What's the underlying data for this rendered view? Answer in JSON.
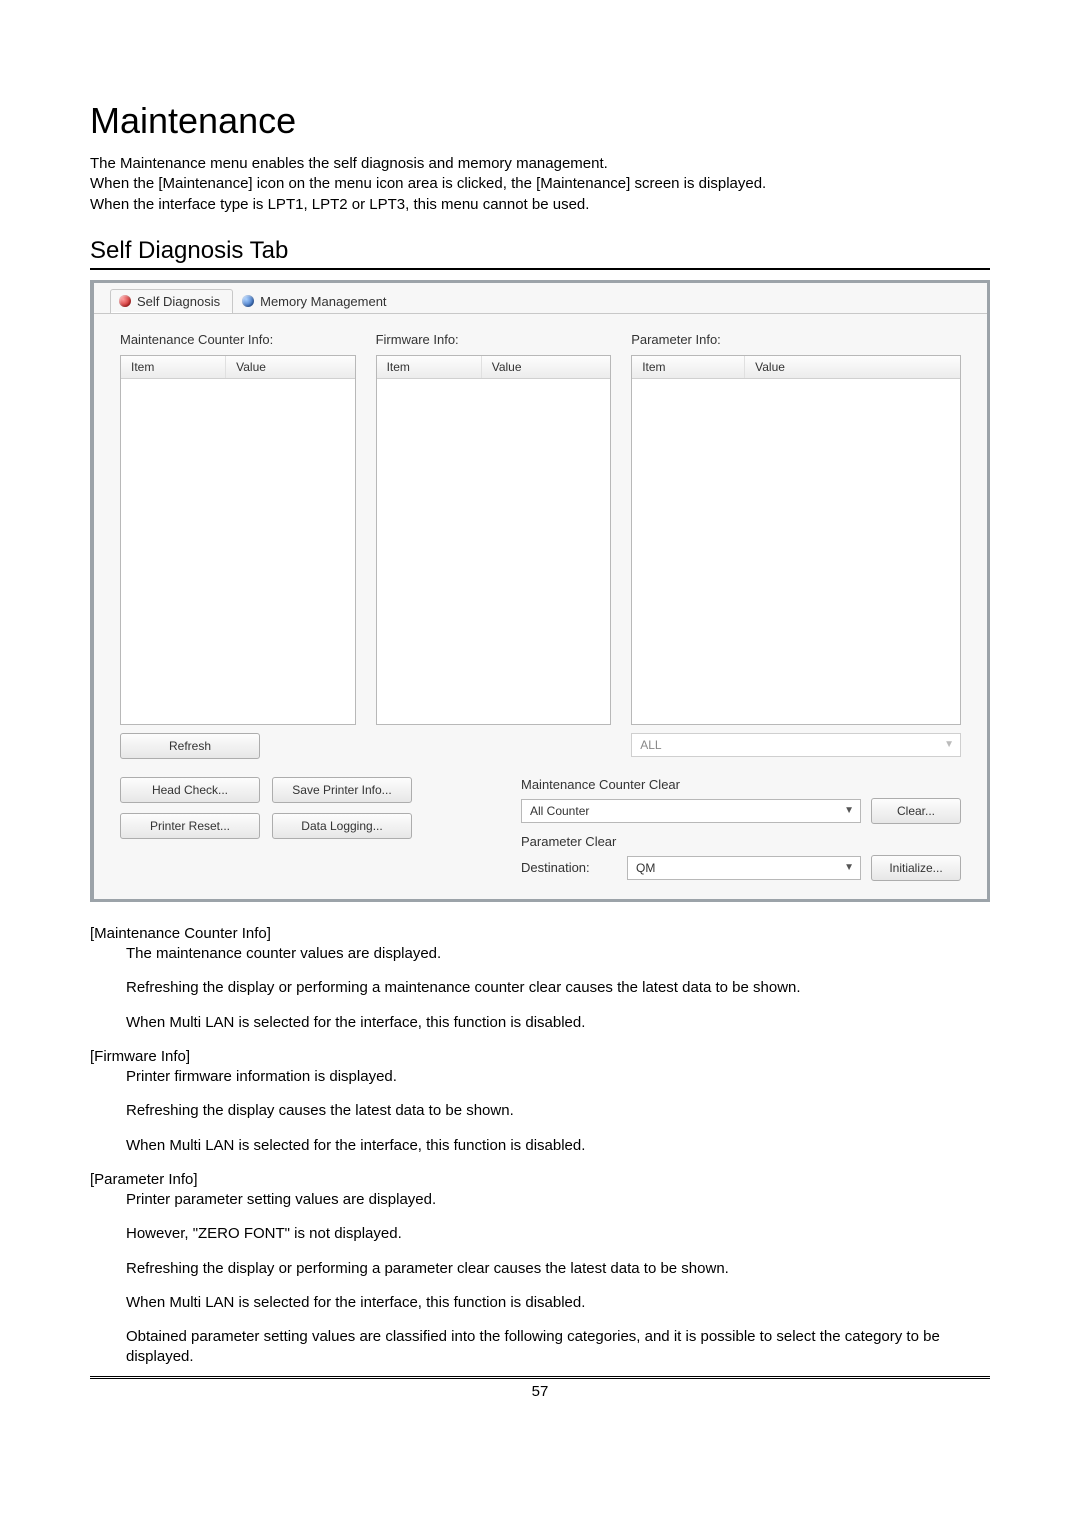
{
  "title": "Maintenance",
  "intro": "The Maintenance menu enables the self diagnosis and memory management.\nWhen the [Maintenance] icon on the menu icon area is clicked, the [Maintenance] screen is displayed.\nWhen the interface type is LPT1, LPT2 or LPT3, this menu cannot be used.",
  "subhead": "Self Diagnosis Tab",
  "tabs": {
    "self_diag": "Self Diagnosis",
    "mem_mgmt": "Memory Management"
  },
  "panel": {
    "maint_counter_label": "Maintenance Counter Info:",
    "firmware_label": "Firmware Info:",
    "parameter_label": "Parameter Info:",
    "col_item": "Item",
    "col_value": "Value",
    "refresh": "Refresh",
    "param_filter": "ALL",
    "head_check": "Head Check...",
    "save_printer_info": "Save Printer Info...",
    "printer_reset": "Printer Reset...",
    "data_logging": "Data Logging...",
    "maint_clear_title": "Maintenance Counter Clear",
    "maint_clear_sel": "All Counter",
    "clear_btn": "Clear...",
    "param_clear_title": "Parameter Clear",
    "dest_label": "Destination:",
    "dest_value": "QM",
    "initialize_btn": "Initialize..."
  },
  "descriptions": [
    {
      "term": "[Maintenance Counter Info]",
      "lines": [
        "The maintenance counter values are displayed.",
        "Refreshing the display or performing a maintenance counter clear causes the latest data to be shown.",
        "When Multi LAN is selected for the interface, this function is disabled."
      ]
    },
    {
      "term": "[Firmware Info]",
      "lines": [
        "Printer firmware information is displayed.",
        "Refreshing the display causes the latest data to be shown.",
        "When Multi LAN is selected for the interface, this function is disabled."
      ]
    },
    {
      "term": "[Parameter Info]",
      "lines": [
        "Printer parameter setting values are displayed.",
        "However, \"ZERO FONT\" is not displayed.",
        "Refreshing the display or performing a parameter clear causes the latest data to be shown.",
        "When Multi LAN is selected for the interface, this function is disabled.",
        "Obtained parameter setting values are classified into the following categories, and it is possible to select the category to be displayed."
      ]
    }
  ],
  "page_number": "57"
}
